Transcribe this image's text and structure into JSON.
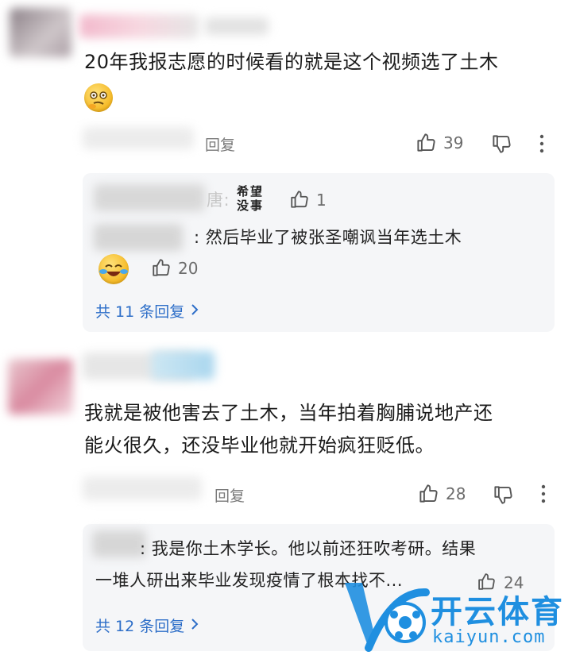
{
  "comments": [
    {
      "text_line1": "20年我报志愿的时候看的就是这个视频选了土木",
      "reply_label": "回复",
      "likes": "39",
      "replies": [
        {
          "suffix": "唐:",
          "likes": "1",
          "sticker": "希望没事"
        },
        {
          "text": ": 然后毕业了被张圣嘲讽当年选土木",
          "likes": "20"
        }
      ],
      "more_replies": "共 11 条回复"
    },
    {
      "text_line1": "我就是被他害去了土木，当年拍着胸脯说地产还",
      "text_line2": "能火很久，还没毕业他就开始疯狂贬低。",
      "reply_label": "回复",
      "likes": "28",
      "replies": [
        {
          "text_line1": ": 我是你土木学长。他以前还狂吹考研。结果",
          "text_line2": "一堆人研出来毕业发现疫情了根本找不...",
          "likes": "24"
        }
      ],
      "more_replies": "共 12 条回复"
    }
  ],
  "watermark": {
    "brand": "开云体育",
    "domain": "kaiyun.com"
  },
  "colors": {
    "link": "#2d6ec8",
    "watermark": "#1f8fe0"
  },
  "icons": [
    "thumbs-up-icon",
    "thumbs-down-icon",
    "more-vertical-icon",
    "chevron-right-icon"
  ]
}
